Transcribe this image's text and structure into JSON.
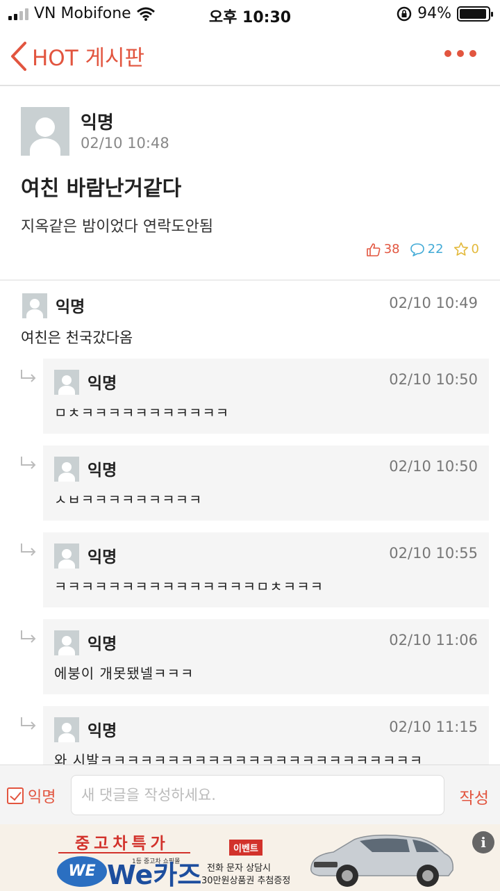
{
  "status_bar": {
    "carrier": "VN Mobifone",
    "time": "오후 10:30",
    "battery_percent": "94%",
    "battery_level": 0.94
  },
  "nav": {
    "title": "HOT 게시판"
  },
  "post": {
    "author": "익명",
    "time": "02/10 10:48",
    "title": "여친 바람난거같다",
    "body": "지옥같은 밤이었다 연락도안됨",
    "likes": "38",
    "comments": "22",
    "scraps": "0"
  },
  "comment": {
    "author": "익명",
    "time": "02/10 10:49",
    "text": "여친은 천국갔다옴"
  },
  "replies": [
    {
      "author": "익명",
      "time": "02/10 10:50",
      "text": "ㅁㅊㅋㅋㅋㅋㅋㅋㅋㅋㅋㅋㅋ"
    },
    {
      "author": "익명",
      "time": "02/10 10:50",
      "text": "ㅅㅂㅋㅋㅋㅋㅋㅋㅋㅋㅋ"
    },
    {
      "author": "익명",
      "time": "02/10 10:55",
      "text": "ㅋㅋㅋㅋㅋㅋㅋㅋㅋㅋㅋㅋㅋㅋㅋㅁㅊㅋㅋㅋ"
    },
    {
      "author": "익명",
      "time": "02/10 11:06",
      "text": "에붕이 개못됐넬ㅋㅋㅋ"
    },
    {
      "author": "익명",
      "time": "02/10 11:15",
      "text": "와 시발ㅋㅋㅋㅋㅋㅋㅋㅋㅋㅋㅋㅋㅋㅋㅋㅋㅋㅋㅋㅋㅋㅋㅋㅋ"
    }
  ],
  "compose": {
    "anonymous_label": "익명",
    "anonymous_checked": true,
    "placeholder": "새 댓글을 작성하세요.",
    "submit_label": "작성"
  },
  "ad": {
    "headline": "중고차특가",
    "tagline": "1등 중고차 쇼핑몰",
    "logo_text": "WE",
    "brand": "We카즈",
    "event_badge": "이벤트",
    "desc_line1": "전화 문자 상담시",
    "desc_line2": "30만원상품권 추첨증정",
    "info_label": "i"
  },
  "colors": {
    "accent": "#e2553f",
    "like": "#e2553f",
    "comment": "#41aad6",
    "scrap": "#e3b93b"
  }
}
